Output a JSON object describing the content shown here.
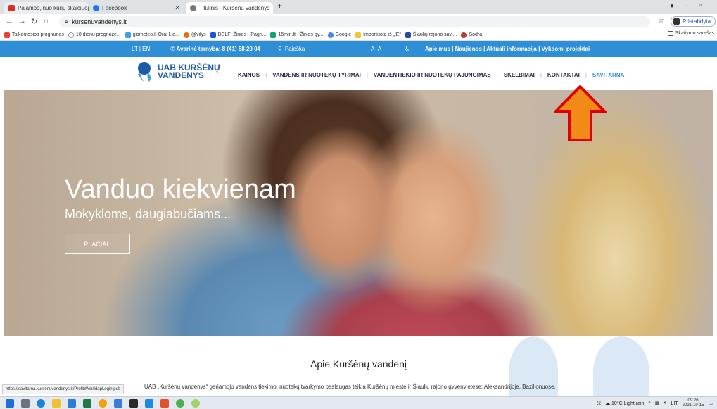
{
  "browser": {
    "tabs": [
      {
        "label": "Pajamos, nuo kurių skaičiuojama",
        "fav_color": "#d93025"
      },
      {
        "label": "Facebook",
        "fav_color": "#1877f2"
      },
      {
        "label": "Titulinis - Kursenu vandenys",
        "fav_color": "#555555"
      }
    ],
    "new_tab": "+",
    "address": "kursenuvandenys.lt",
    "profile_label": "Pristabdyta",
    "bookmarks": [
      {
        "label": "Taikomosios programos",
        "color": "#ea4335"
      },
      {
        "label": "10 dienų prognoze...",
        "color": "#999999"
      },
      {
        "label": "gismeteo.lt Orai Lie...",
        "color": "#3ba0e6"
      },
      {
        "label": "@vilys",
        "color": "#e8710a"
      },
      {
        "label": "DELFI Žinios - Pagri...",
        "color": "#1a56db"
      },
      {
        "label": "15min.lt - Žinios gy...",
        "color": "#13a36f"
      },
      {
        "label": "Google",
        "color": "#4285f4"
      },
      {
        "label": "Importuota iš „IE“",
        "color": "#f4c430"
      },
      {
        "label": "Šiaulių rajono savi...",
        "color": "#2b4aa0"
      },
      {
        "label": "Sodra",
        "color": "#c0392b"
      }
    ],
    "reading_list": "Skaitymo sąrašas",
    "status_url": "https://savitarna.kursenuvandenys.lt/ProfitWeb/IdapLogin.pub"
  },
  "site": {
    "topbar": {
      "lang": "LT | EN",
      "emergency": "Avarinė tarnyba: 8 (41) 58 20 04",
      "search_placeholder": "Paieška",
      "font_size": "A-  A+",
      "links": "Apie mus  |  Naujienos  |  Aktuali informacija  |  Vykdomi projektai"
    },
    "logo": {
      "line1": "UAB KURŠĖNŲ",
      "line2": "VANDENYS"
    },
    "nav": [
      "KAINOS",
      "VANDENS IR NUOTEKŲ TYRIMAI",
      "VANDENTIEKIO IR NUOTEKŲ PAJUNGIMAS",
      "SKELBIMAI",
      "KONTAKTAI",
      "SAVITARNA"
    ],
    "hero": {
      "title": "Vanduo kiekvienam",
      "subtitle": "Mokykloms, daugiabučiams...",
      "button": "PLAČIAU"
    },
    "about": {
      "title": "Apie Kuršėnų vandenį",
      "text": "UAB „Kuršėnų vandenys“ geriamojo vandens tiekimo, nuotekų tvarkymo paslaugas teikia Kuršėnų mieste ir Šiaulių rajono gyvenvietėse: Aleksandrijoje, Bazilionuose,"
    }
  },
  "taskbar": {
    "weather": "10°C  Light rain",
    "lang": "LIT",
    "time": "09:26",
    "date": "2021-10-15"
  }
}
